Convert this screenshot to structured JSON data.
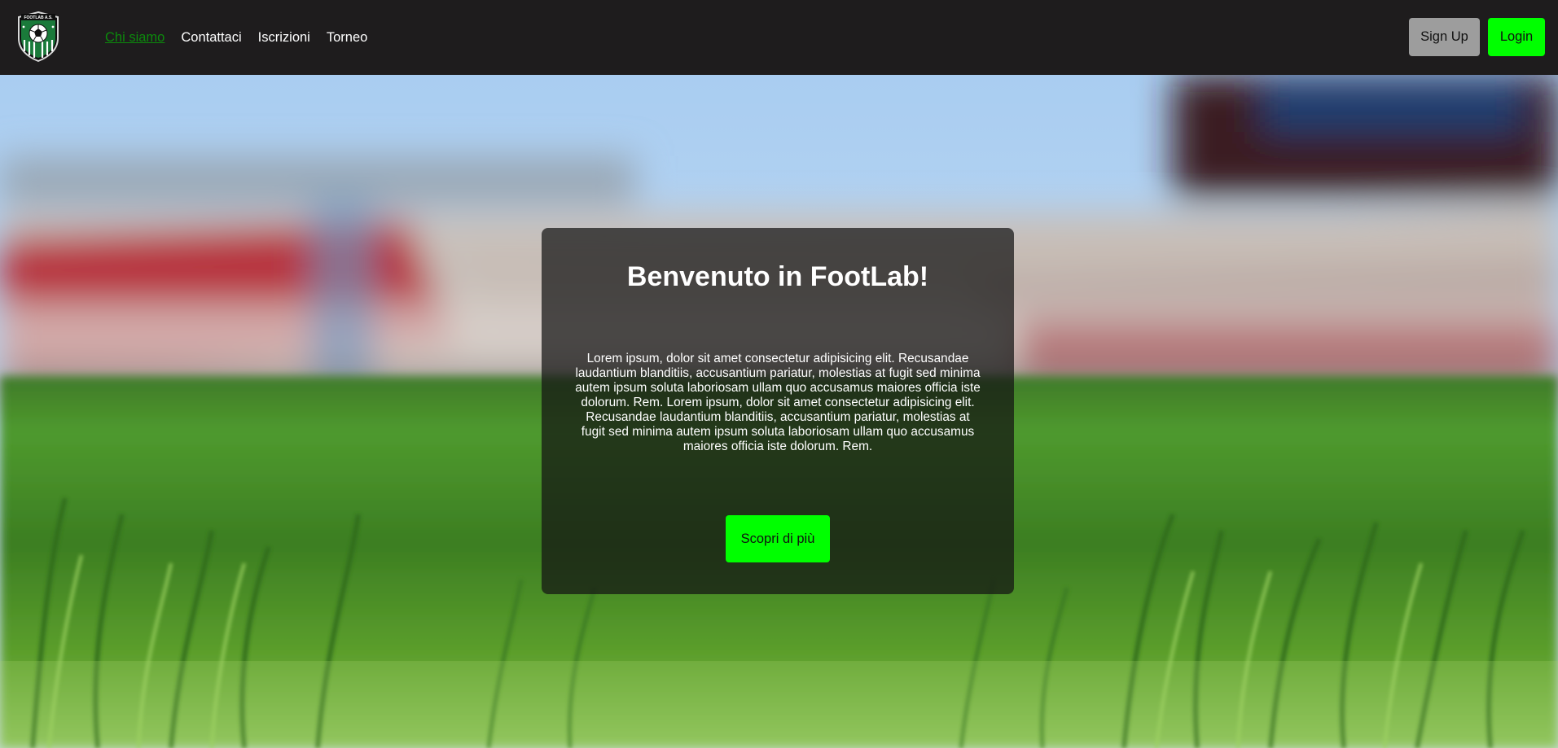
{
  "brand": {
    "logo_name": "FOOTLAB A.S.",
    "accent_color": "#00ff00"
  },
  "nav": {
    "items": [
      {
        "label": "Chi siamo",
        "active": true
      },
      {
        "label": "Contattaci",
        "active": false
      },
      {
        "label": "Iscrizioni",
        "active": false
      },
      {
        "label": "Torneo",
        "active": false
      }
    ]
  },
  "auth": {
    "signup_label": "Sign Up",
    "login_label": "Login"
  },
  "hero": {
    "title": "Benvenuto in FootLab!",
    "text": "Lorem ipsum, dolor sit amet consectetur adipisicing elit. Recusandae laudantium blanditiis, accusantium pariatur, molestias at fugit sed minima autem ipsum soluta laboriosam ullam quo accusamus maiores officia iste dolorum. Rem. Lorem ipsum, dolor sit amet consectetur adipisicing elit. Recusandae laudantium blanditiis, accusantium pariatur, molestias at fugit sed minima autem ipsum soluta laboriosam ullam quo accusamus maiores officia iste dolorum. Rem.",
    "cta_label": "Scopri di più",
    "background_image": "blurred-stadium-grass"
  }
}
